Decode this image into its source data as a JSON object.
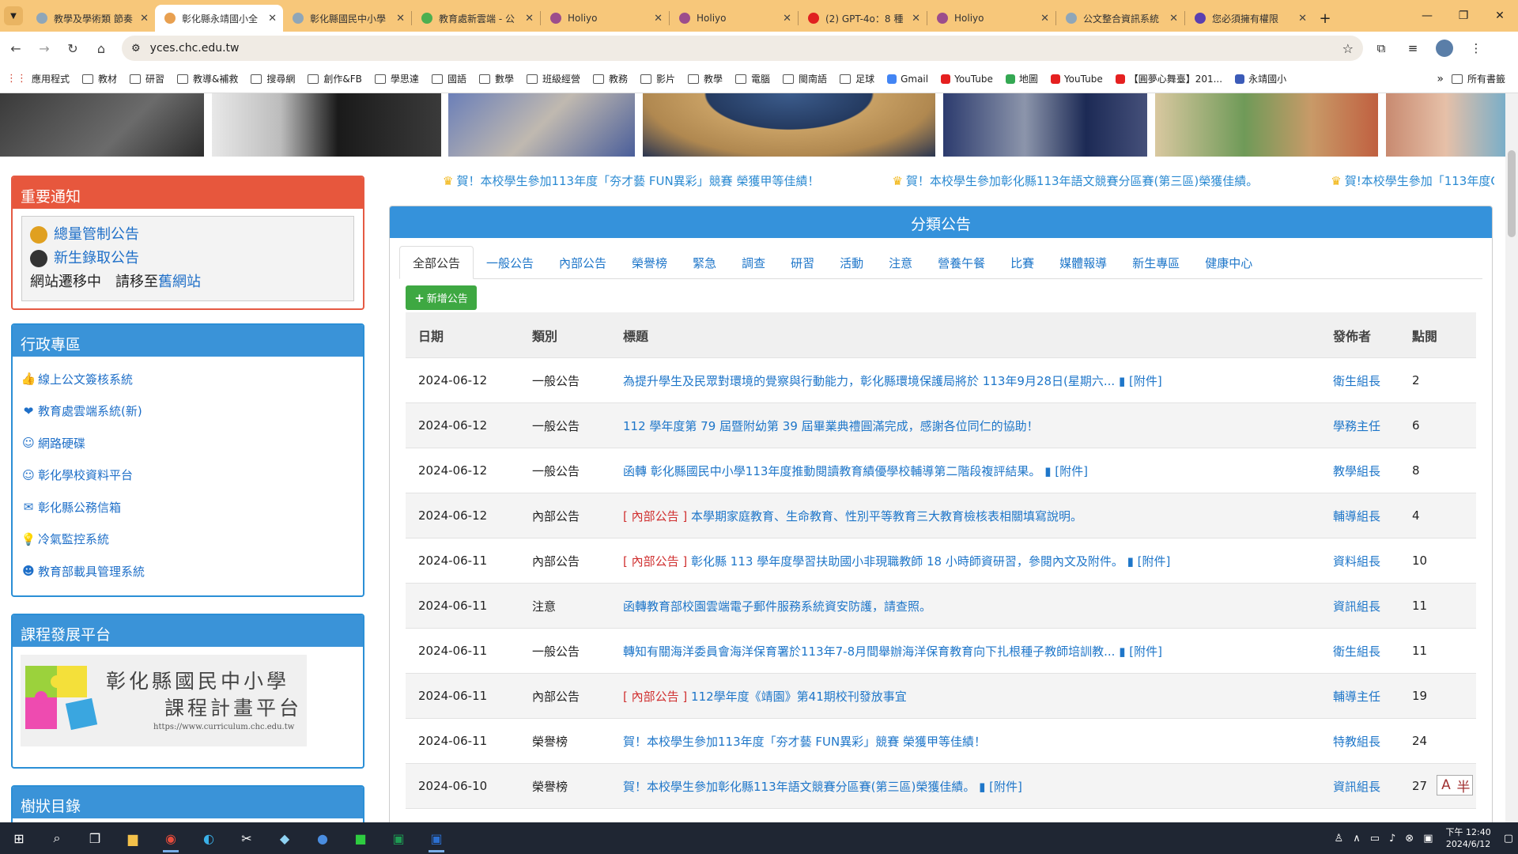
{
  "browser": {
    "tabs": [
      {
        "title": "教學及學術類 節奏",
        "active": false,
        "color": "#8fa6b8"
      },
      {
        "title": "彰化縣永靖國小全",
        "active": true,
        "color": "#e8a050"
      },
      {
        "title": "彰化縣國民中小學",
        "active": false,
        "color": "#8fa6b8"
      },
      {
        "title": "教育處新雲端 - 公",
        "active": false,
        "color": "#4caf50"
      },
      {
        "title": "Holiyo",
        "active": false,
        "color": "#9c4d8c"
      },
      {
        "title": "Holiyo",
        "active": false,
        "color": "#9c4d8c"
      },
      {
        "title": "(2) GPT-4o：8 種",
        "active": false,
        "color": "#e02020"
      },
      {
        "title": "Holiyo",
        "active": false,
        "color": "#9c4d8c"
      },
      {
        "title": "公文整合資訊系統",
        "active": false,
        "color": "#8fa6b8"
      },
      {
        "title": "您必須擁有權限",
        "active": false,
        "color": "#5a3fb0"
      }
    ],
    "new_tab": "+",
    "url": "yces.chc.edu.tw",
    "bookmarks": [
      {
        "label": "應用程式",
        "kind": "apps"
      },
      {
        "label": "教材",
        "kind": "folder"
      },
      {
        "label": "研習",
        "kind": "folder"
      },
      {
        "label": "教導&補救",
        "kind": "folder"
      },
      {
        "label": "搜尋網",
        "kind": "folder"
      },
      {
        "label": "創作&FB",
        "kind": "folder"
      },
      {
        "label": "學思達",
        "kind": "folder"
      },
      {
        "label": "國語",
        "kind": "folder"
      },
      {
        "label": "數學",
        "kind": "folder"
      },
      {
        "label": "班級經營",
        "kind": "folder"
      },
      {
        "label": "教務",
        "kind": "folder"
      },
      {
        "label": "影片",
        "kind": "folder"
      },
      {
        "label": "教學",
        "kind": "folder"
      },
      {
        "label": "電腦",
        "kind": "folder"
      },
      {
        "label": "閩南語",
        "kind": "folder"
      },
      {
        "label": "足球",
        "kind": "folder"
      },
      {
        "label": "Gmail",
        "kind": "google"
      },
      {
        "label": "YouTube",
        "kind": "youtube"
      },
      {
        "label": "地圖",
        "kind": "maps"
      },
      {
        "label": "YouTube",
        "kind": "youtube"
      },
      {
        "label": "【圓夢心舞臺】201...",
        "kind": "youtube"
      },
      {
        "label": "永靖國小",
        "kind": "site"
      }
    ],
    "bookmarks_more": "»",
    "all_bookmarks": "所有書籤"
  },
  "notice_panel": {
    "title": "重要通知",
    "links": [
      "總量管制公告",
      "新生錄取公告"
    ],
    "migration_text": "網站遷移中　請移至",
    "migration_link": "舊網站"
  },
  "admin_panel": {
    "title": "行政專區",
    "items": [
      {
        "label": "線上公文簽核系統",
        "icon": "thumbs-up-icon",
        "glyph": "👍"
      },
      {
        "label": "教育處雲端系統(新)",
        "icon": "heart-icon",
        "glyph": "❤"
      },
      {
        "label": "網路硬碟",
        "icon": "smile-icon",
        "glyph": "☺"
      },
      {
        "label": "彰化學校資料平台",
        "icon": "smile-icon",
        "glyph": "☺"
      },
      {
        "label": "彰化縣公務信箱",
        "icon": "envelope-icon",
        "glyph": "✉"
      },
      {
        "label": "冷氣監控系統",
        "icon": "bulb-icon",
        "glyph": "💡"
      },
      {
        "label": "教育部載具管理系統",
        "icon": "devil-icon",
        "glyph": "☻"
      }
    ]
  },
  "curriculum_panel": {
    "title": "課程發展平台",
    "logo_line1": "彰化縣國民中小學",
    "logo_line2": "課程計畫平台",
    "logo_url": "https://www.curriculum.chc.edu.tw"
  },
  "tree_panel": {
    "title": "樹狀目錄"
  },
  "marquee": [
    "賀！本校學生參加113年度「夯才藝 FUN異彩」競賽 榮獲甲等佳績！",
    "賀！本校學生參加彰化縣113年語文競賽分區賽(第三區)榮獲佳績。",
    "賀!本校學生參加「113年度Cool"
  ],
  "announcements": {
    "title": "分類公告",
    "tabs": [
      "全部公告",
      "一般公告",
      "內部公告",
      "榮譽榜",
      "緊急",
      "調查",
      "研習",
      "活動",
      "注意",
      "營養午餐",
      "比賽",
      "媒體報導",
      "新生專區",
      "健康中心"
    ],
    "add_button": "新增公告",
    "columns": {
      "date": "日期",
      "category": "類別",
      "title": "標題",
      "publisher": "發佈者",
      "clicks": "點閱"
    },
    "inner_prefix": "[ 內部公告 ]",
    "attachment_label": "[附件]",
    "rows": [
      {
        "date": "2024-06-12",
        "category": "一般公告",
        "inner": false,
        "title": "為提升學生及民眾對環境的覺察與行動能力，彰化縣環境保護局將於 113年9月28日(星期六...",
        "attach": true,
        "publisher": "衛生組長",
        "clicks": "2"
      },
      {
        "date": "2024-06-12",
        "category": "一般公告",
        "inner": false,
        "title": "112 學年度第 79 屆暨附幼第 39 屆畢業典禮圓滿完成，感謝各位同仁的協助！",
        "attach": false,
        "publisher": "學務主任",
        "clicks": "6"
      },
      {
        "date": "2024-06-12",
        "category": "一般公告",
        "inner": false,
        "title": "函轉 彰化縣國民中小學113年度推動閱讀教育績優學校輔導第二階段複評結果。",
        "attach": true,
        "publisher": "教學組長",
        "clicks": "8"
      },
      {
        "date": "2024-06-12",
        "category": "內部公告",
        "inner": true,
        "title": "本學期家庭教育、生命教育、性別平等教育三大教育檢核表相關填寫說明。",
        "attach": false,
        "publisher": "輔導組長",
        "clicks": "4"
      },
      {
        "date": "2024-06-11",
        "category": "內部公告",
        "inner": true,
        "title": "彰化縣 113 學年度學習扶助國小非現職教師 18 小時師資研習，參閱內文及附件。",
        "attach": true,
        "publisher": "資料組長",
        "clicks": "10"
      },
      {
        "date": "2024-06-11",
        "category": "注意",
        "inner": false,
        "title": "函轉教育部校園雲端電子郵件服務系統資安防護，請查照。",
        "attach": false,
        "publisher": "資訊組長",
        "clicks": "11"
      },
      {
        "date": "2024-06-11",
        "category": "一般公告",
        "inner": false,
        "title": "轉知有關海洋委員會海洋保育署於113年7-8月間舉辦海洋保育教育向下扎根種子教師培訓教...",
        "attach": true,
        "publisher": "衛生組長",
        "clicks": "11"
      },
      {
        "date": "2024-06-11",
        "category": "內部公告",
        "inner": true,
        "title": "112學年度《靖園》第41期校刊發放事宜",
        "attach": false,
        "publisher": "輔導主任",
        "clicks": "19"
      },
      {
        "date": "2024-06-11",
        "category": "榮譽榜",
        "inner": false,
        "title": "賀！本校學生參加113年度「夯才藝 FUN異彩」競賽 榮獲甲等佳績！",
        "attach": false,
        "publisher": "特教組長",
        "clicks": "24"
      },
      {
        "date": "2024-06-10",
        "category": "榮譽榜",
        "inner": false,
        "title": "賀！本校學生參加彰化縣113年語文競賽分區賽(第三區)榮獲佳績。",
        "attach": true,
        "publisher": "資訊組長",
        "clicks": "27"
      }
    ]
  },
  "ime": {
    "a": "A",
    "b": "半"
  },
  "taskbar": {
    "time": "下午 12:40",
    "date": "2024/6/12"
  }
}
